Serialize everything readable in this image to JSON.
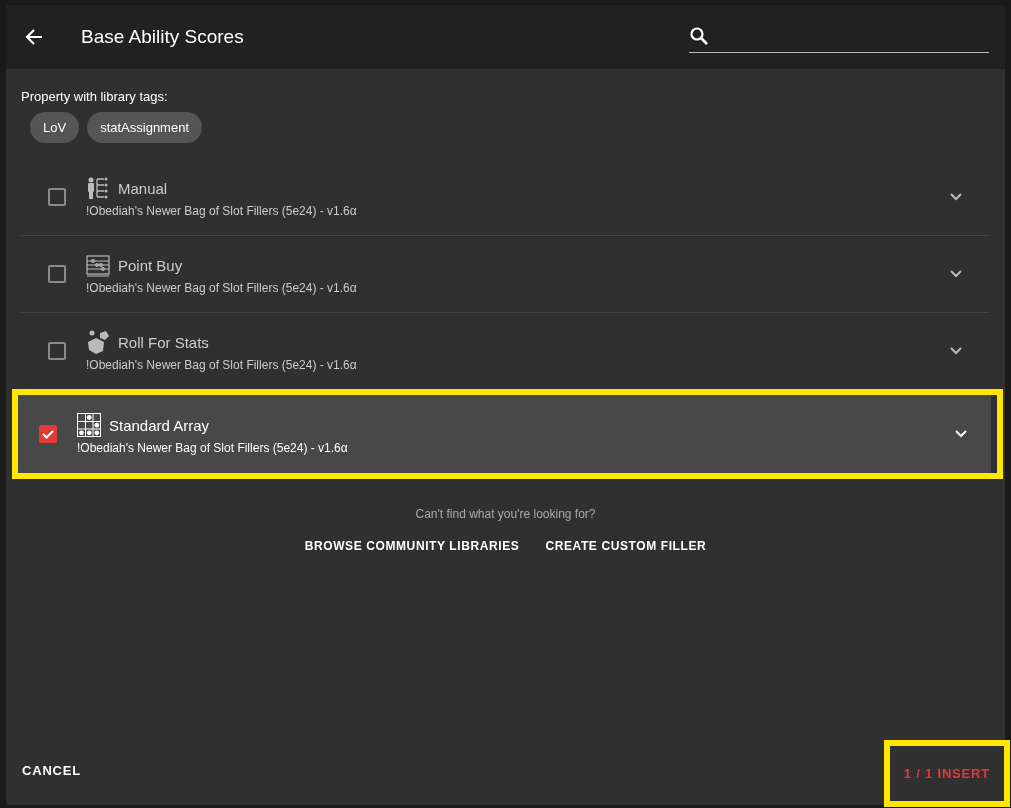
{
  "dialog": {
    "title": "Base Ability Scores"
  },
  "tags_label": "Property with library tags:",
  "tags": [
    "LoV",
    "statAssignment"
  ],
  "items": [
    {
      "title": "Manual",
      "subtitle": "!Obediah's Newer Bag of Slot Fillers (5e24) - v1.6α",
      "checked": false,
      "highlighted": false
    },
    {
      "title": "Point Buy",
      "subtitle": "!Obediah's Newer Bag of Slot Fillers (5e24) - v1.6α",
      "checked": false,
      "highlighted": false
    },
    {
      "title": "Roll For Stats",
      "subtitle": "!Obediah's Newer Bag of Slot Fillers (5e24) - v1.6α",
      "checked": false,
      "highlighted": false
    },
    {
      "title": "Standard Array",
      "subtitle": "!Obediah's Newer Bag of Slot Fillers (5e24) - v1.6α",
      "checked": true,
      "highlighted": true
    }
  ],
  "hint": "Can't find what you're looking for?",
  "links": [
    "BROWSE COMMUNITY LIBRARIES",
    "CREATE CUSTOM FILLER"
  ],
  "footer": {
    "cancel": "CANCEL",
    "insert": "1 / 1 INSERT",
    "insert_highlighted": true
  }
}
